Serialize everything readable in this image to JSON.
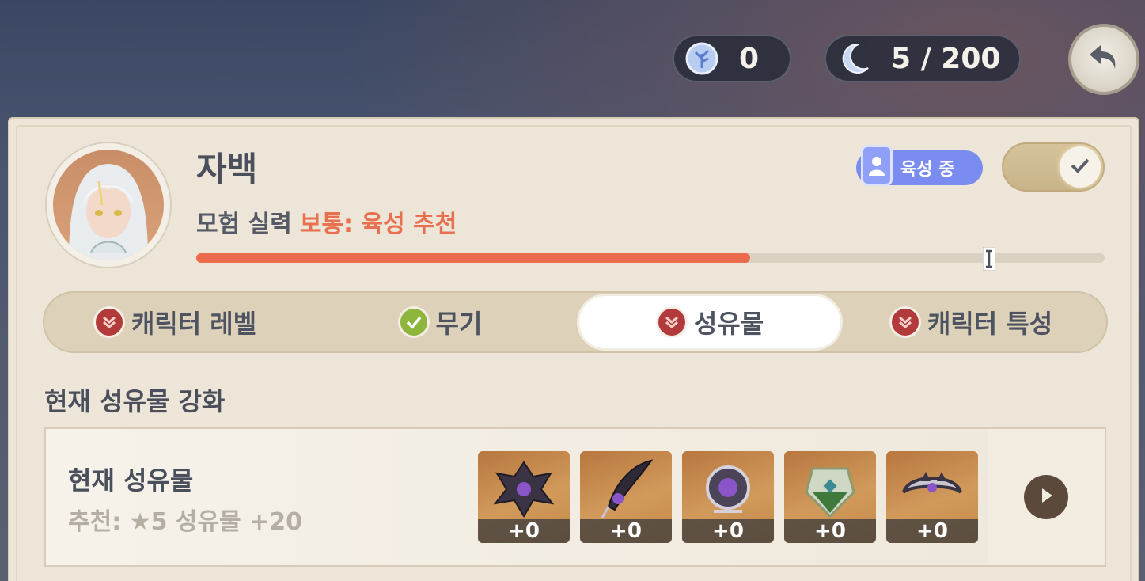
{
  "currencies": [
    {
      "icon": "starglitter-orb-icon",
      "value": "0"
    },
    {
      "icon": "crescent-moon-resin-icon",
      "value": "5 / 200"
    }
  ],
  "character": {
    "name": "자백",
    "skill_label": "모험 실력",
    "skill_recommendation": "보통: 육성 추천",
    "progress_fraction": 0.61
  },
  "badge": {
    "label": "육성 중",
    "icon": "character-portrait-icon"
  },
  "toggle": {
    "checked": true
  },
  "tabs": [
    {
      "label": "캐릭터 레벨",
      "status": "pending",
      "active": false
    },
    {
      "label": "무기",
      "status": "done",
      "active": false
    },
    {
      "label": "성유물",
      "status": "pending",
      "active": true
    },
    {
      "label": "캐릭터 특성",
      "status": "pending",
      "active": false
    }
  ],
  "section_title": "현재 성유물 강화",
  "artifacts_card": {
    "title": "현재 성유물",
    "subtitle": "추천: ★5 성유물 +20",
    "slots": [
      {
        "name": "flower-of-life-artifact-icon",
        "level": "+0"
      },
      {
        "name": "plume-of-death-artifact-icon",
        "level": "+0"
      },
      {
        "name": "sands-of-eon-artifact-icon",
        "level": "+0"
      },
      {
        "name": "goblet-of-eonothem-artifact-icon",
        "level": "+0"
      },
      {
        "name": "circlet-of-logos-artifact-icon",
        "level": "+0"
      }
    ]
  },
  "colors": {
    "accent_orange": "#ec6a4c",
    "panel_bg": "#ece5d8",
    "badge_blue": "#7a8cf0",
    "tab_red": "#b33a3a",
    "tab_green": "#8fb63c"
  }
}
